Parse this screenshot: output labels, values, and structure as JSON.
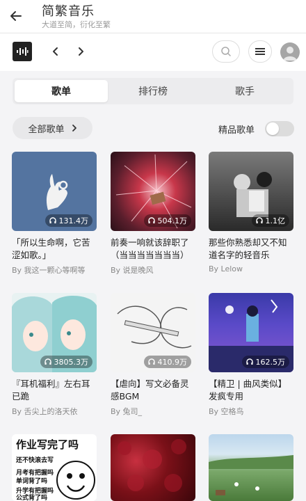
{
  "app": {
    "title": "简繁音乐",
    "subtitle": "大道至简，衍化至繁"
  },
  "tabs": [
    {
      "label": "歌单",
      "active": true
    },
    {
      "label": "排行榜",
      "active": false
    },
    {
      "label": "歌手",
      "active": false
    }
  ],
  "filter": {
    "all_label": "全部歌单",
    "quality_label": "精品歌单",
    "quality_enabled": false
  },
  "playlists": [
    {
      "title": "「所以生命啊，它苦涩如歌。」",
      "author": "By 我这一颗心等啊等",
      "plays": "131.4万"
    },
    {
      "title": "前奏一响就该辞职了（当当当当当当当）",
      "author": "By 说是晚风",
      "plays": "504.1万"
    },
    {
      "title": "那些你熟悉却又不知道名字的轻音乐",
      "author": "By Lelow",
      "plays": "1.1亿"
    },
    {
      "title": "『耳机福利』左右耳已跪",
      "author": "By 舌尖上的洛天依",
      "plays": "3805.3万"
    },
    {
      "title": "【虐向】写文必备灵感BGM",
      "author": "By 兔司_",
      "plays": "410.9万"
    },
    {
      "title": "【精卫 | 曲风类似】发疯专用",
      "author": "By 空格鸟",
      "plays": "162.5万"
    },
    {
      "cover_text": "作业写完了吗",
      "cover_lines": [
        "还不快滚去写",
        "月考有把握吗",
        "单词背了吗",
        "升学有把握吗",
        "公式背了吗"
      ]
    }
  ],
  "icons": {
    "back": "arrow-left-icon",
    "logo": "waveform-icon",
    "prev": "chevron-left-icon",
    "next": "chevron-right-icon",
    "search": "search-icon",
    "menu": "menu-icon",
    "headphones": "headphones-icon"
  }
}
